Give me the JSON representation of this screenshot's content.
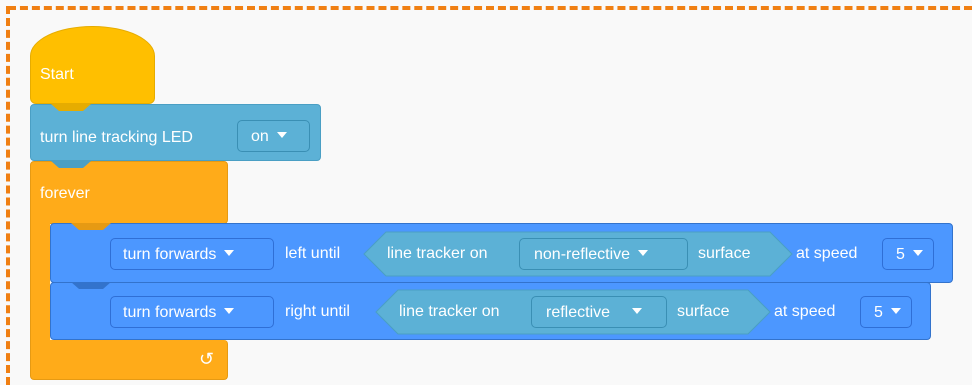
{
  "hat_block": {
    "label": "Start"
  },
  "led_block": {
    "label": "turn line tracking LED",
    "state_value": "on"
  },
  "forever_block": {
    "label": "forever",
    "loop_icon": "rotate-arrow-icon",
    "loop_glyph": "↺"
  },
  "motion_blocks": [
    {
      "turn_dropdown": "turn forwards",
      "direction_text": "left until",
      "condition": {
        "prefix": "line tracker on",
        "surface_value": "non-reflective",
        "suffix": "surface"
      },
      "speed_label": "at speed",
      "speed_value": "5"
    },
    {
      "turn_dropdown": "turn forwards",
      "direction_text": "right until",
      "condition": {
        "prefix": "line tracker on",
        "surface_value": "reflective",
        "suffix": "surface"
      },
      "speed_label": "at speed",
      "speed_value": "5"
    }
  ],
  "colors": {
    "event_yellow": "#ffbf00",
    "looks_cyan": "#5cb1d6",
    "control_orange": "#ffab19",
    "motion_blue": "#4c97ff",
    "sensing_light_blue": "#5cb1d6",
    "selection_dash": "#f07f12"
  }
}
